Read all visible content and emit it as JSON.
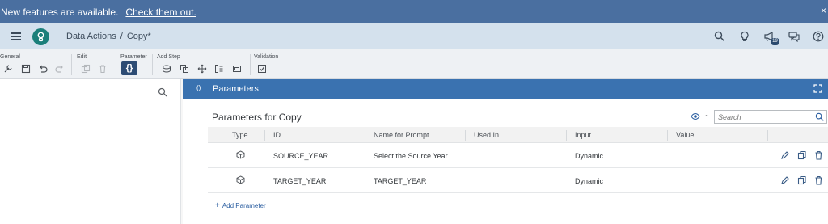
{
  "banner": {
    "text": "New features are available.",
    "link": "Check them out.",
    "close": "×"
  },
  "shell": {
    "breadcrumb_root": "Data Actions",
    "breadcrumb_sep": "/",
    "breadcrumb_current": "Copy*",
    "notification_count": "19"
  },
  "toolbar": {
    "groups": {
      "general": "General",
      "edit": "Edit",
      "parameter": "Parameter",
      "add_step": "Add Step",
      "validation": "Validation"
    },
    "parameter_button": "{}"
  },
  "panel": {
    "header_icon": "()",
    "header_title": "Parameters",
    "title": "Parameters for Copy",
    "search_placeholder": "Search",
    "columns": [
      "Type",
      "ID",
      "Name for Prompt",
      "Used In",
      "Input",
      "Value"
    ],
    "rows": [
      {
        "id": "SOURCE_YEAR",
        "prompt": "Select the Source Year",
        "used_in": "",
        "input": "Dynamic",
        "value": ""
      },
      {
        "id": "TARGET_YEAR",
        "prompt": "TARGET_YEAR",
        "used_in": "",
        "input": "Dynamic",
        "value": ""
      }
    ],
    "add_label": "Add Parameter"
  },
  "colors": {
    "banner": "#4a6fa0",
    "shell": "#d4e1ed",
    "panel_header": "#3a72b0",
    "avatar": "#1b7f7a",
    "link": "#2b5ea0"
  }
}
